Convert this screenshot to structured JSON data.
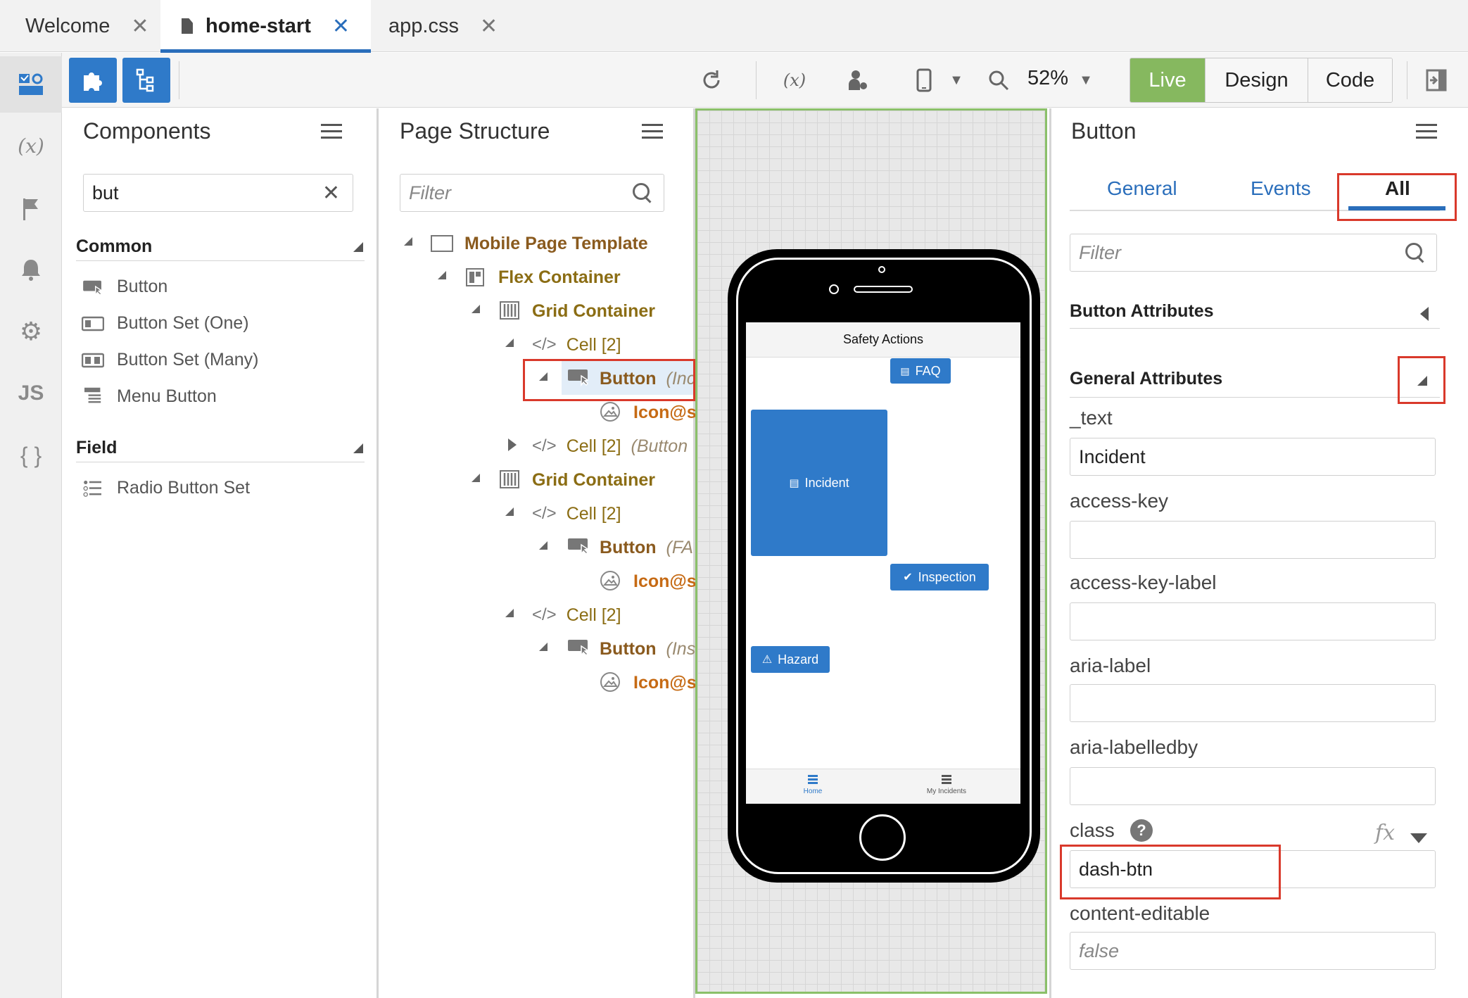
{
  "tabs": [
    {
      "label": "Welcome",
      "active": false
    },
    {
      "label": "home-start",
      "active": true
    },
    {
      "label": "app.css",
      "active": false
    }
  ],
  "toolbar": {
    "zoom": "52%",
    "modes": [
      "Live",
      "Design",
      "Code"
    ],
    "active_mode": "Live"
  },
  "rail": {
    "items": [
      "designer-icon",
      "variables-icon",
      "flag-icon",
      "bell-icon",
      "gear-icon",
      "JS",
      "{ }"
    ]
  },
  "components": {
    "title": "Components",
    "search_value": "but",
    "sections": [
      {
        "name": "Common",
        "items": [
          "Button",
          "Button Set (One)",
          "Button Set (Many)",
          "Menu Button"
        ]
      },
      {
        "name": "Field",
        "items": [
          "Radio Button Set"
        ]
      }
    ]
  },
  "structure": {
    "title": "Page Structure",
    "filter_placeholder": "Filter",
    "tree": [
      {
        "label": "Mobile Page Template",
        "sub": ""
      },
      {
        "label": "Flex Container",
        "sub": ""
      },
      {
        "label": "Grid Container",
        "sub": ""
      },
      {
        "label": "Cell [2]",
        "sub": ""
      },
      {
        "label": "Button",
        "sub": "(Inc"
      },
      {
        "label": "Icon@s",
        "sub": ""
      },
      {
        "label": "Cell [2]",
        "sub": "(Button"
      },
      {
        "label": "Grid Container",
        "sub": ""
      },
      {
        "label": "Cell [2]",
        "sub": ""
      },
      {
        "label": "Button",
        "sub": "(FA"
      },
      {
        "label": "Icon@s",
        "sub": ""
      },
      {
        "label": "Cell [2]",
        "sub": ""
      },
      {
        "label": "Button",
        "sub": "(Ins"
      },
      {
        "label": "Icon@s",
        "sub": ""
      }
    ]
  },
  "preview": {
    "header": "Safety Actions",
    "buttons": {
      "faq": "FAQ",
      "incident": "Incident",
      "inspection": "Inspection",
      "hazard": "Hazard"
    },
    "footer": [
      "Home",
      "My Incidents"
    ]
  },
  "properties": {
    "title": "Button",
    "tabs": [
      "General",
      "Events",
      "All"
    ],
    "active_tab": "All",
    "filter_placeholder": "Filter",
    "section_button_attrs": "Button Attributes",
    "section_general_attrs": "General Attributes",
    "fields": [
      {
        "label": "_text",
        "value": "Incident"
      },
      {
        "label": "access-key",
        "value": ""
      },
      {
        "label": "access-key-label",
        "value": ""
      },
      {
        "label": "aria-label",
        "value": ""
      },
      {
        "label": "aria-labelledby",
        "value": ""
      },
      {
        "label": "class",
        "value": "dash-btn"
      },
      {
        "label": "content-editable",
        "value": "false"
      }
    ],
    "fx_label": "fx"
  },
  "colors": {
    "accent": "#2a6ebb",
    "live": "#86b85f",
    "highlight": "#d9392b",
    "tree_label": "#8a5a1e"
  }
}
